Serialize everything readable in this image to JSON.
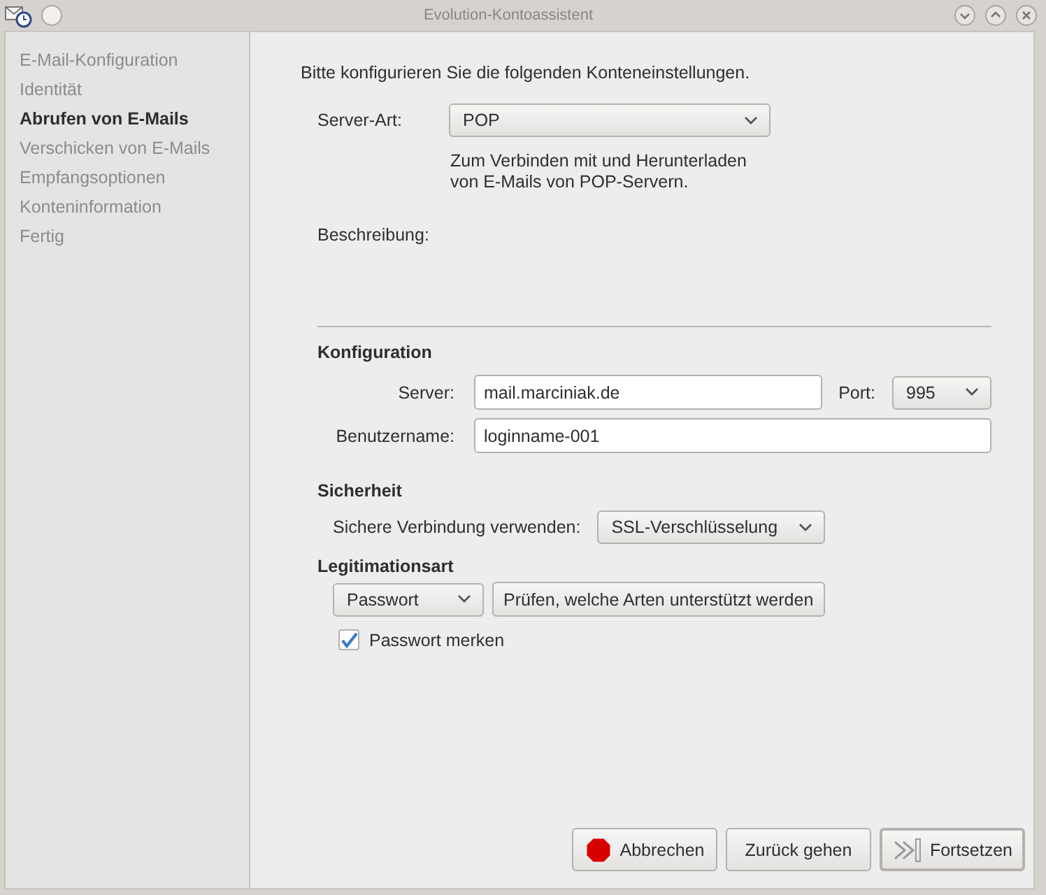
{
  "window": {
    "title": "Evolution-Kontoassistent"
  },
  "steps": [
    {
      "label": "E-Mail-Konfiguration",
      "selected": false
    },
    {
      "label": "Identität",
      "selected": false
    },
    {
      "label": "Abrufen von E-Mails",
      "selected": true
    },
    {
      "label": "Verschicken von E-Mails",
      "selected": false
    },
    {
      "label": "Empfangsoptionen",
      "selected": false
    },
    {
      "label": "Konteninformation",
      "selected": false
    },
    {
      "label": "Fertig",
      "selected": false
    }
  ],
  "intro": "Bitte konfigurieren Sie die folgenden Konteneinstellungen.",
  "server_type": {
    "label": "Server-Art:",
    "value": "POP",
    "description": "Zum Verbinden mit und Herunterladen\nvon E-Mails von POP-Servern."
  },
  "description_label": "Beschreibung:",
  "configuration": {
    "title": "Konfiguration",
    "server": {
      "label": "Server:",
      "value": "mail.marciniak.de"
    },
    "port": {
      "label": "Port:",
      "value": "995"
    },
    "username": {
      "label": "Benutzername:",
      "value": "loginname-001"
    }
  },
  "security": {
    "title": "Sicherheit",
    "label": "Sichere Verbindung verwenden:",
    "value": "SSL-Verschlüsselung"
  },
  "authentication": {
    "title": "Legitimationsart",
    "method": "Passwort",
    "check_button": "Prüfen, welche Arten unterstützt werden",
    "remember": {
      "label": "Passwort merken",
      "checked": true
    }
  },
  "buttons": [
    {
      "label": "Abbrechen",
      "kind": "cancel"
    },
    {
      "label": "Zurück gehen",
      "kind": "back"
    },
    {
      "label": "Fortsetzen",
      "kind": "forward"
    }
  ]
}
